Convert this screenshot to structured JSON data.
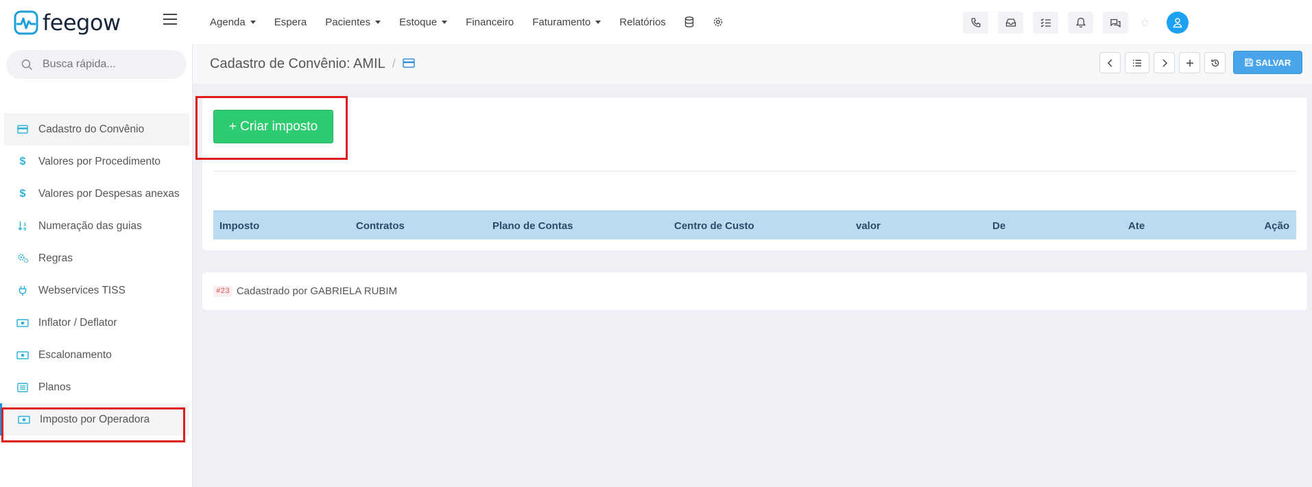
{
  "app": {
    "logo_text": "feegow",
    "brand_color": "#1a9fd9"
  },
  "topnav": {
    "items": [
      {
        "label": "Agenda",
        "dropdown": true
      },
      {
        "label": "Espera",
        "dropdown": false
      },
      {
        "label": "Pacientes",
        "dropdown": true
      },
      {
        "label": "Estoque",
        "dropdown": true
      },
      {
        "label": "Financeiro",
        "dropdown": false
      },
      {
        "label": "Faturamento",
        "dropdown": true
      },
      {
        "label": "Relatórios",
        "dropdown": false
      }
    ],
    "icons": [
      "database-icon",
      "settings-icon"
    ],
    "right_buttons": [
      "phone-icon",
      "inbox-icon",
      "tasks-icon",
      "bell-icon",
      "chat-icon"
    ]
  },
  "search": {
    "placeholder": "Busca rápida..."
  },
  "sidebar": {
    "items": [
      {
        "label": "Cadastro do Convênio",
        "icon": "card-icon"
      },
      {
        "label": "Valores por Procedimento",
        "icon": "dollar-icon"
      },
      {
        "label": "Valores por Despesas anexas",
        "icon": "dollar-icon"
      },
      {
        "label": "Numeração das guias",
        "icon": "sort-icon"
      },
      {
        "label": "Regras",
        "icon": "gears-icon"
      },
      {
        "label": "Webservices TISS",
        "icon": "plug-icon"
      },
      {
        "label": "Inflator / Deflator",
        "icon": "money-icon"
      },
      {
        "label": "Escalonamento",
        "icon": "money-icon"
      },
      {
        "label": "Planos",
        "icon": "list-icon"
      },
      {
        "label": "Imposto por Operadora",
        "icon": "money-icon"
      }
    ]
  },
  "page": {
    "title": "Cadastro de Convênio: AMIL",
    "separator": "/",
    "save_label": "SALVAR"
  },
  "impostos": {
    "create_label": "+ Criar imposto",
    "columns": [
      "Imposto",
      "Contratos",
      "Plano de Contas",
      "Centro de Custo",
      "valor",
      "De",
      "Ate",
      "Ação"
    ]
  },
  "footer": {
    "record_id": "#23",
    "created_by": "Cadastrado por GABRIELA RUBIM"
  }
}
